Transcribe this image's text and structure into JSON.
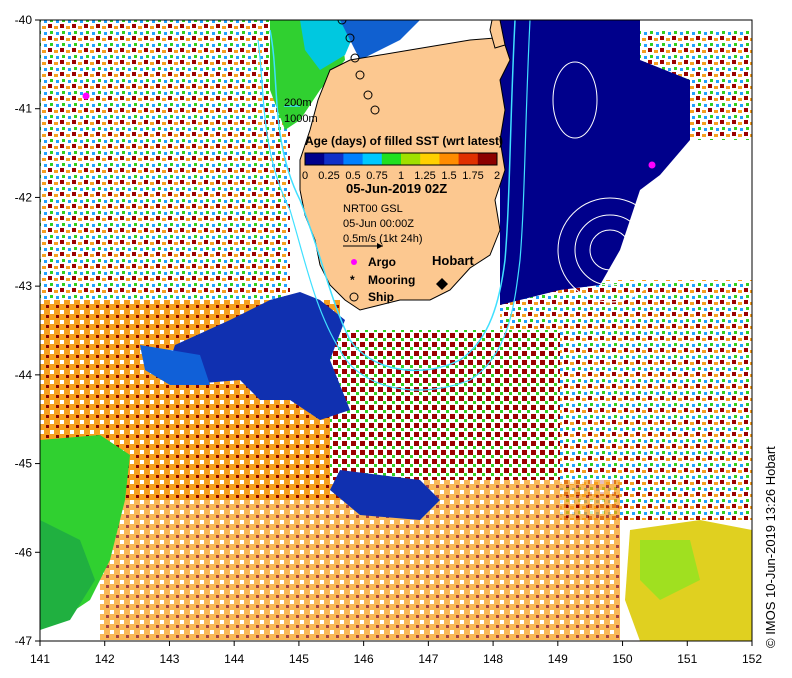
{
  "map": {
    "lon_ticks": [
      "141",
      "142",
      "143",
      "144",
      "145",
      "146",
      "147",
      "148",
      "149",
      "150",
      "151",
      "152"
    ],
    "lat_ticks": [
      "-40",
      "-41",
      "-42",
      "-43",
      "-44",
      "-45",
      "-46",
      "-47"
    ],
    "lon_range": [
      141,
      152
    ],
    "lat_range": [
      -47,
      -40
    ]
  },
  "legend": {
    "isobath_200": "200m",
    "isobath_1000": "1000m",
    "colorbar_title": "Age (days) of filled SST (wrt latest)",
    "colorbar_ticks": [
      "0",
      "0.25",
      "0.5",
      "0.75",
      "1",
      "1.25",
      "1.5",
      "1.75",
      "2"
    ],
    "colorbar_colors": [
      "#00008b",
      "#1030c8",
      "#0080ff",
      "#00c8ff",
      "#20e020",
      "#a0e000",
      "#ffd000",
      "#ff8c00",
      "#e03000",
      "#8b0000"
    ],
    "date": "05-Jun-2019 02Z",
    "product": "NRT00 GSL",
    "current_time": "05-Jun 00:00Z",
    "vector_scale": "0.5m/s (1kt 24h)",
    "argo_label": "Argo",
    "mooring_label": "Mooring",
    "ship_label": "Ship"
  },
  "places": {
    "hobart": "Hobart"
  },
  "colors": {
    "land": "#fcc890",
    "ocean_empty": "#ffffff",
    "deep_blue": "#00008b",
    "isobath": "#40e0ff",
    "argo": "#ff00ff"
  },
  "credit": "© IMOS 10-Jun-2019 13:26 Hobart"
}
